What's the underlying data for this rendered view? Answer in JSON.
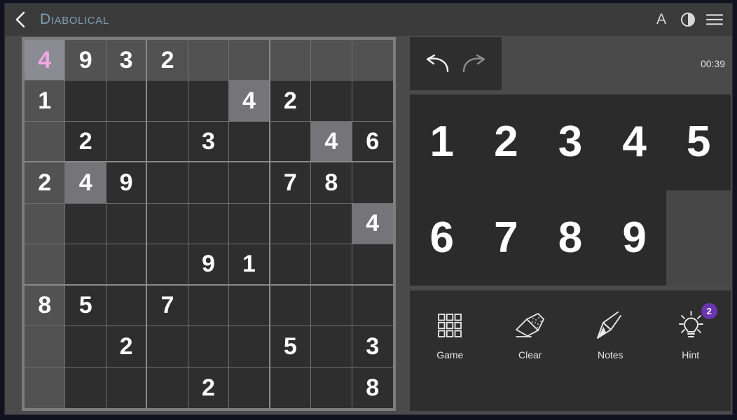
{
  "window": {
    "background": "#4a4a4a",
    "frame_color": "#12121e"
  },
  "header": {
    "back_icon": "chevron-left-icon",
    "title": "Diabolical",
    "title_color": "#7e9eb0",
    "icons": [
      {
        "name": "font-size-icon",
        "glyph": "A"
      },
      {
        "name": "contrast-icon",
        "glyph": "half-circle"
      },
      {
        "name": "menu-icon",
        "glyph": "hamburger"
      }
    ]
  },
  "board": {
    "selected": {
      "row": 0,
      "col": 0
    },
    "selected_value": "4",
    "selected_text_color": "#f0a8e4",
    "rows": [
      [
        "4",
        "9",
        "3",
        "2",
        "",
        "",
        "",
        "",
        ""
      ],
      [
        "1",
        "",
        "",
        "",
        "",
        "4",
        "2",
        "",
        ""
      ],
      [
        "",
        "2",
        "",
        "",
        "3",
        "",
        "",
        "4",
        "6"
      ],
      [
        "2",
        "4",
        "9",
        "",
        "",
        "",
        "7",
        "8",
        ""
      ],
      [
        "",
        "",
        "",
        "",
        "",
        "",
        "",
        "",
        "4"
      ],
      [
        "",
        "",
        "",
        "",
        "9",
        "1",
        "",
        "",
        ""
      ],
      [
        "8",
        "5",
        "",
        "7",
        "",
        "",
        "",
        "",
        ""
      ],
      [
        "",
        "",
        "2",
        "",
        "",
        "",
        "5",
        "",
        "3"
      ],
      [
        "",
        "",
        "",
        "",
        "2",
        "",
        "",
        "",
        "8"
      ]
    ]
  },
  "controls": {
    "undo_label": "undo-icon",
    "redo_label": "redo-icon",
    "undo_enabled": true,
    "redo_enabled": false,
    "timer": "00:39"
  },
  "numpad": {
    "numbers": [
      "1",
      "2",
      "3",
      "4",
      "5",
      "6",
      "7",
      "8",
      "9"
    ],
    "empty_slot": ""
  },
  "actions": [
    {
      "name": "game",
      "label": "Game",
      "icon": "grid-icon"
    },
    {
      "name": "clear",
      "label": "Clear",
      "icon": "eraser-icon"
    },
    {
      "name": "notes",
      "label": "Notes",
      "icon": "pencil-icon"
    },
    {
      "name": "hint",
      "label": "Hint",
      "icon": "lightbulb-icon",
      "badge": "2",
      "badge_color": "#6b34b0"
    }
  ]
}
